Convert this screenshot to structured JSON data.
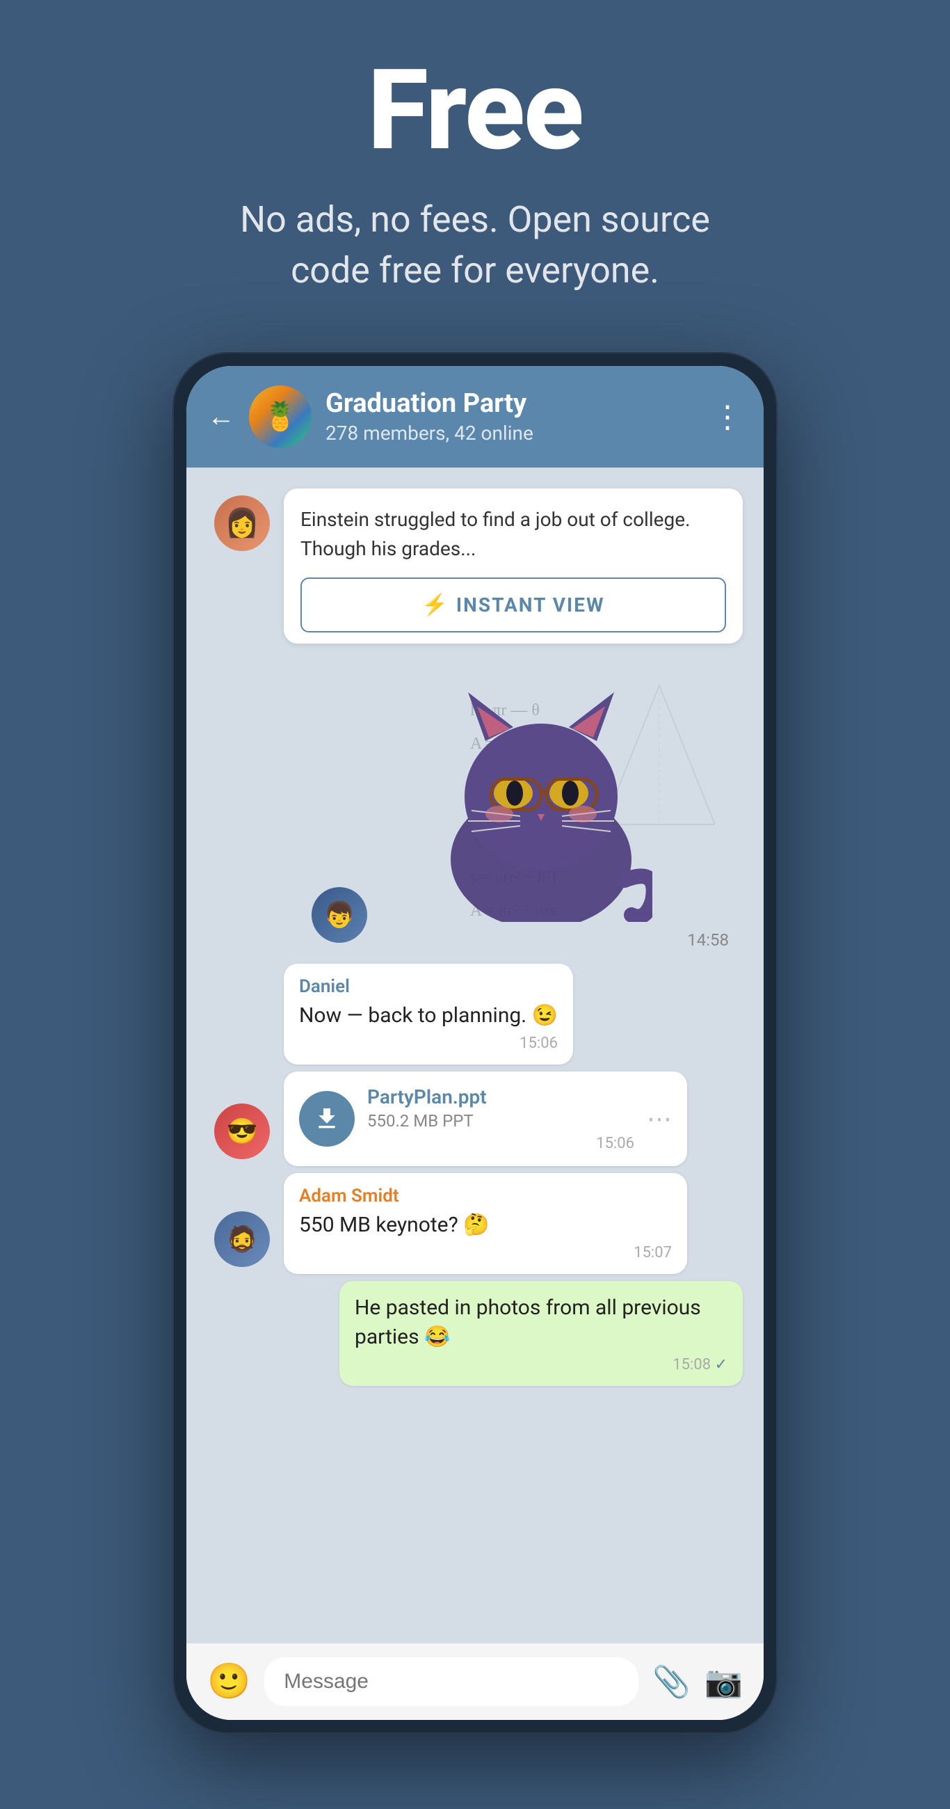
{
  "hero": {
    "title": "Free",
    "subtitle": "No ads, no fees. Open source code free for everyone."
  },
  "chat": {
    "back_label": "←",
    "group_name": "Graduation Party",
    "group_meta": "278 members, 42 online",
    "more_icon": "⋮"
  },
  "article": {
    "text": "Einstein struggled to find a job out of college. Though his grades...",
    "instant_view_label": "INSTANT VIEW",
    "lightning": "⚡"
  },
  "sticker": {
    "time": "14:58"
  },
  "messages": [
    {
      "id": "daniel-msg",
      "sender": "Daniel",
      "text": "Now — back to planning. 😉",
      "time": "15:06",
      "type": "received"
    },
    {
      "id": "file-msg",
      "file_name": "PartyPlan.ppt",
      "file_size": "550.2 MB PPT",
      "time": "15:06",
      "type": "file"
    },
    {
      "id": "adam-msg",
      "sender": "Adam Smidt",
      "text": "550 MB keynote? 🤔",
      "time": "15:07",
      "type": "received"
    },
    {
      "id": "own-msg",
      "text": "He pasted in photos from all previous parties 😂",
      "time": "15:08",
      "type": "sent"
    }
  ],
  "input": {
    "placeholder": "Message"
  }
}
